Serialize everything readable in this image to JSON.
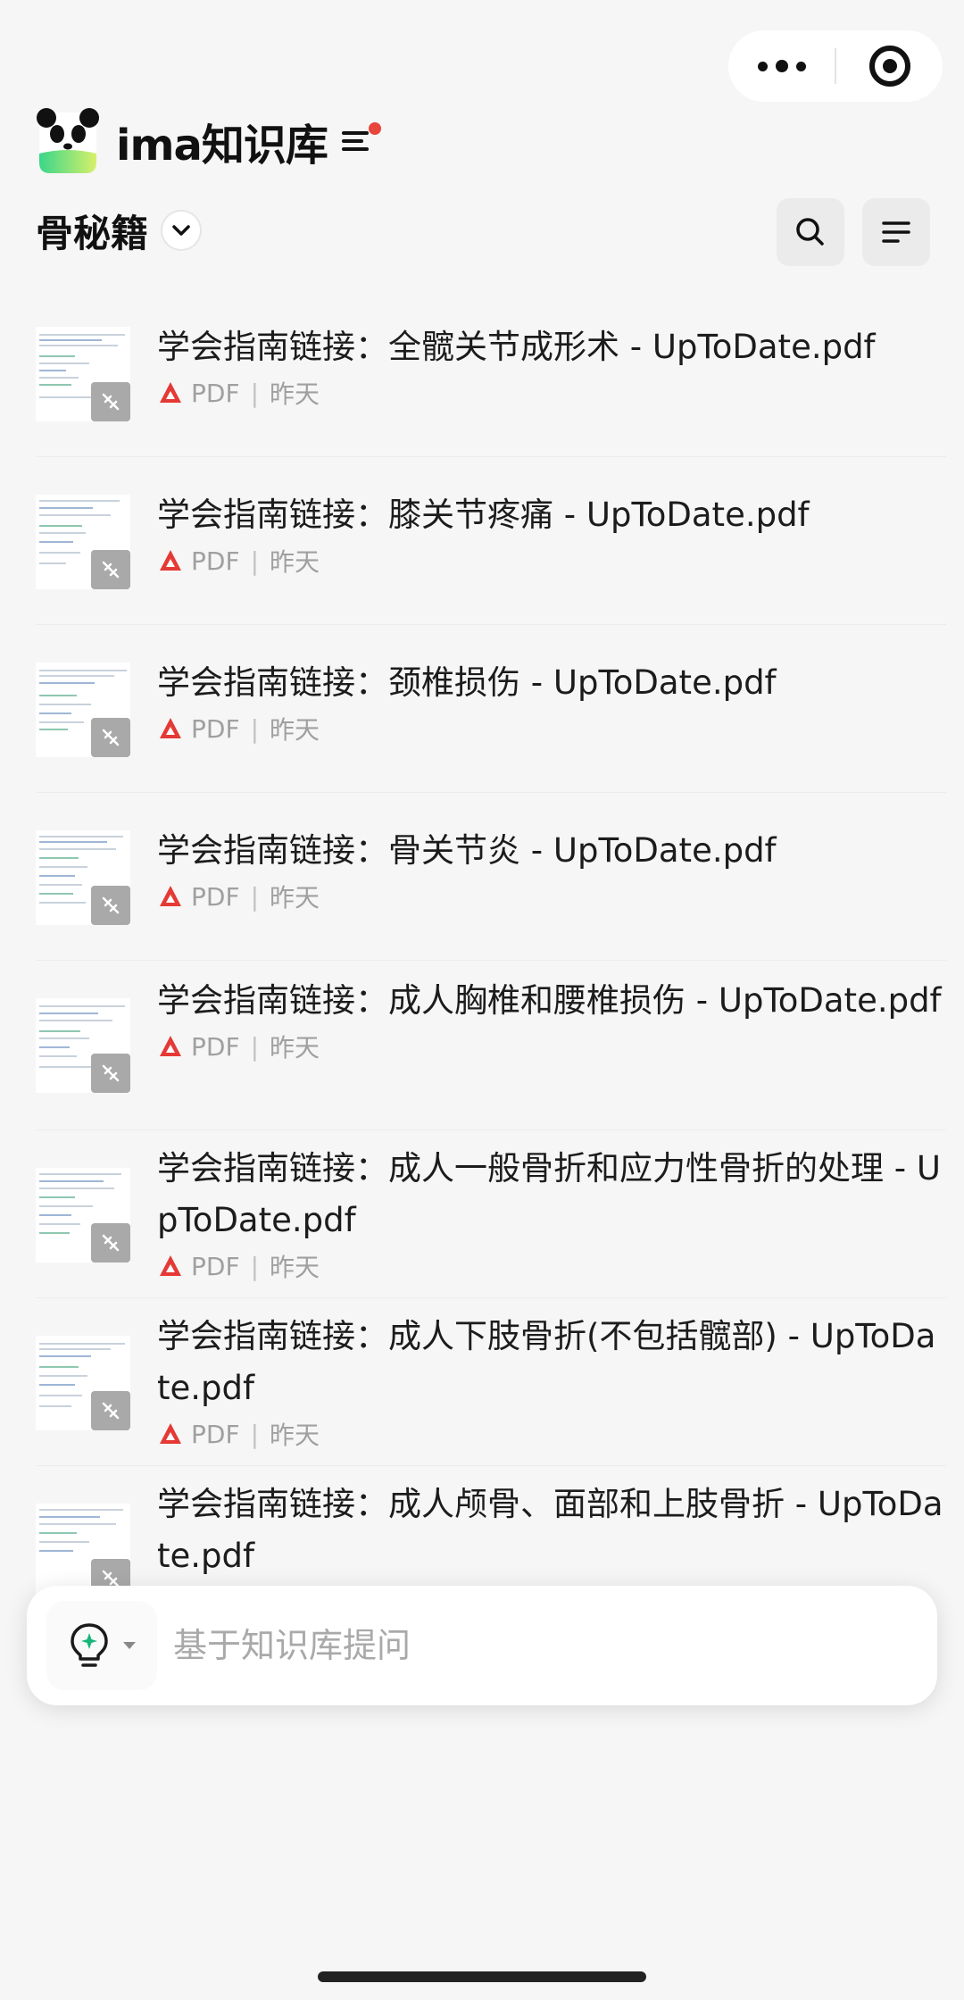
{
  "colors": {
    "background": "#f6f6f6",
    "pdf_red": "#e53935",
    "unread_dot": "#e8453c",
    "logo_green": "#3bd68a"
  },
  "header": {
    "app_title": "ima知识库",
    "folder_name": "骨秘籍"
  },
  "icons": {
    "more": "more-dots-icon",
    "close": "target-circle-icon",
    "menu": "menu-lines-icon",
    "chevron": "chevron-down-icon",
    "search": "search-icon",
    "sort": "sort-lines-icon",
    "file_badge": "link-off-icon",
    "pdf": "pdf-icon",
    "ask_mode": "lightbulb-sparkle-icon"
  },
  "files": [
    {
      "title": "学会指南链接：全髋关节成形术 - UpToDate.pdf",
      "type": "PDF",
      "date": "昨天"
    },
    {
      "title": "学会指南链接：膝关节疼痛 - UpToDate.pdf",
      "type": "PDF",
      "date": "昨天"
    },
    {
      "title": "学会指南链接：颈椎损伤 - UpToDate.pdf",
      "type": "PDF",
      "date": "昨天"
    },
    {
      "title": "学会指南链接：骨关节炎 - UpToDate.pdf",
      "type": "PDF",
      "date": "昨天"
    },
    {
      "title": "学会指南链接：成人胸椎和腰椎损伤 - UpToDate.pdf",
      "type": "PDF",
      "date": "昨天"
    },
    {
      "title": "学会指南链接：成人一般骨折和应力性骨折的处理 - UpToDate.pdf",
      "type": "PDF",
      "date": "昨天"
    },
    {
      "title": "学会指南链接：成人下肢骨折(不包括髋部) - UpToDate.pdf",
      "type": "PDF",
      "date": "昨天"
    },
    {
      "title": "学会指南链接：成人颅骨、面部和上肢骨折 - UpToDate.pdf",
      "type": "PDF",
      "date": ""
    }
  ],
  "ask": {
    "placeholder": "基于知识库提问"
  }
}
